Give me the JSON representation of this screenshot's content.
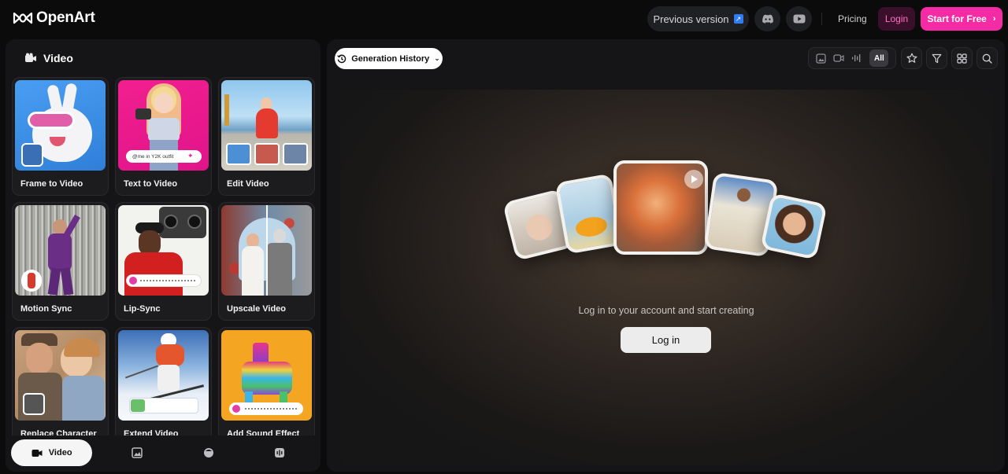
{
  "header": {
    "logo_text": "OpenArt",
    "previous_version_label": "Previous version",
    "pricing_label": "Pricing",
    "login_label": "Login",
    "start_label": "Start for Free",
    "accent_color": "#f52ba5"
  },
  "sidebar": {
    "title": "Video",
    "cards": [
      {
        "label": "Frame to Video"
      },
      {
        "label": "Text to Video",
        "overlay_text": "@me in Y2K outfit"
      },
      {
        "label": "Edit Video"
      },
      {
        "label": "Motion Sync"
      },
      {
        "label": "Lip-Sync"
      },
      {
        "label": "Upscale Video"
      },
      {
        "label": "Replace Character"
      },
      {
        "label": "Extend Video"
      },
      {
        "label": "Add Sound Effect"
      }
    ],
    "tabs": [
      {
        "label": "Video",
        "icon": "video-icon",
        "active": true
      },
      {
        "label": "",
        "icon": "image-icon",
        "active": false
      },
      {
        "label": "",
        "icon": "face-icon",
        "active": false
      },
      {
        "label": "",
        "icon": "audio-icon",
        "active": false
      }
    ]
  },
  "main": {
    "history_label": "Generation History",
    "filter_all_label": "All",
    "empty_message": "Log in to your account and start creating",
    "login_button_label": "Log in"
  }
}
